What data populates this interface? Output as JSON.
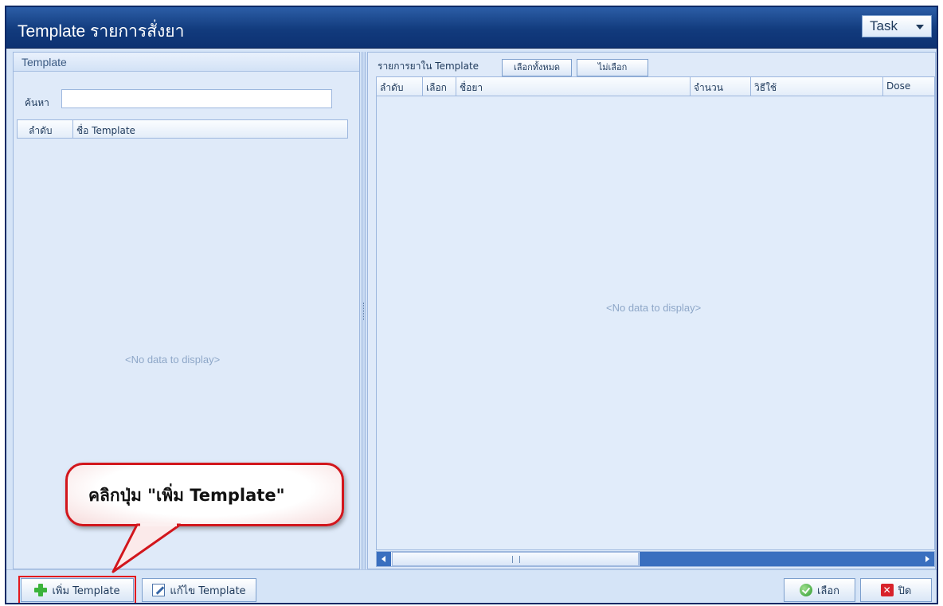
{
  "window": {
    "title": "Template รายการสั่งยา",
    "task_label": "Task"
  },
  "left_panel": {
    "title": "Template",
    "search_label": "ค้นหา",
    "search_value": "",
    "columns": [
      "ลำดับ",
      "ชื่อ Template"
    ],
    "empty_text": "<No data to display>"
  },
  "right_panel": {
    "label": "รายการยาใน Template",
    "select_all_label": "เลือกทั้งหมด",
    "deselect_label": "ไม่เลือก",
    "columns": [
      "ลำดับ",
      "เลือก",
      "ชื่อยา",
      "จำนวน",
      "วิธีใช้",
      "Dose"
    ],
    "empty_text": "<No data to display>"
  },
  "bottom": {
    "add_label": "เพิ่ม Template",
    "edit_label": "แก้ไข Template",
    "select_label": "เลือก",
    "close_label": "ปิด"
  },
  "callout": {
    "text": "คลิกปุ่ม \"เพิ่ม Template\""
  },
  "icons": {
    "add": "plus-icon",
    "edit": "edit-icon",
    "select": "check-icon",
    "close": "close-icon"
  }
}
